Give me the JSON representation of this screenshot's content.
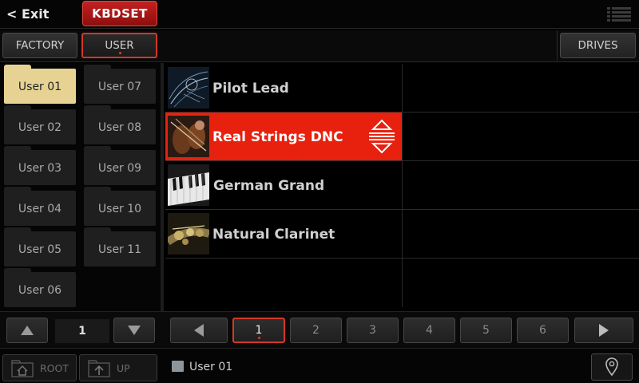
{
  "header": {
    "exit_label": "< Exit",
    "mode_label": "KBDSET",
    "menu_icon": "list-menu-icon"
  },
  "tabs": {
    "factory": "FACTORY",
    "user": "USER",
    "drives": "DRIVES",
    "selected": "USER"
  },
  "folders": [
    {
      "label": "User 01",
      "selected": true
    },
    {
      "label": "User 02"
    },
    {
      "label": "User 03"
    },
    {
      "label": "User 04"
    },
    {
      "label": "User 05"
    },
    {
      "label": "User 06"
    },
    {
      "label": "User 07"
    },
    {
      "label": "User 08"
    },
    {
      "label": "User 09"
    },
    {
      "label": "User 10"
    },
    {
      "label": "User 11"
    }
  ],
  "folder_nav": {
    "page": "1"
  },
  "sounds": [
    {
      "name": "Pilot Lead",
      "thumb_icon": "synth-lead-thumbnail"
    },
    {
      "name": "Real Strings DNC",
      "thumb_icon": "strings-thumbnail",
      "selected": true
    },
    {
      "name": "German Grand",
      "thumb_icon": "piano-keys-thumbnail"
    },
    {
      "name": "Natural Clarinet",
      "thumb_icon": "clarinet-thumbnail"
    }
  ],
  "pages": [
    "1",
    "2",
    "3",
    "4",
    "5",
    "6"
  ],
  "current_page": "1",
  "footer": {
    "root_label": "ROOT",
    "up_label": "UP",
    "path": "User 01"
  },
  "colors": {
    "accent_red": "#e8200e",
    "selected_folder": "#e6d394",
    "folder_bg": "#1f1f1f",
    "background": "#000000"
  }
}
